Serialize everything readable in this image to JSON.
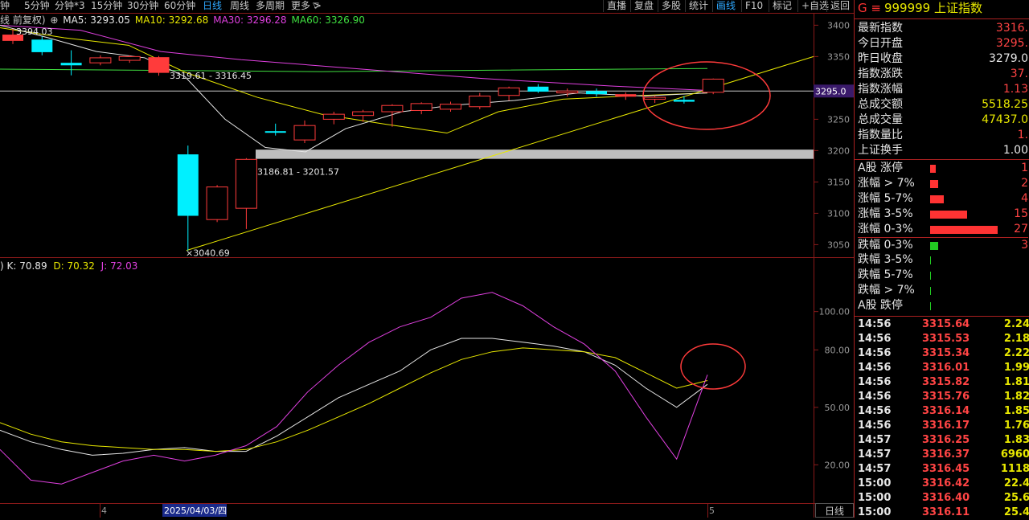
{
  "toolbar": {
    "left_items": [
      "钟",
      "5分钟",
      "分钟*3",
      "15分钟",
      "30分钟",
      "60分钟",
      "日线",
      "周线",
      "多周期",
      "更多 >"
    ],
    "selected": "日线",
    "right_items": [
      "直播",
      "复盘",
      "多股",
      "统计",
      "画线",
      "F10",
      "标记",
      "+自选",
      "返回"
    ],
    "right_selected": "画线"
  },
  "ma_legend": {
    "prefix": "线 前复权)",
    "items": [
      {
        "label": "MA5: 3293.05",
        "color": "#e6e6e6"
      },
      {
        "label": "MA10: 3292.68",
        "color": "#e8e800"
      },
      {
        "label": "MA30: 3296.28",
        "color": "#e040e0"
      },
      {
        "label": "MA60: 3326.90",
        "color": "#40e040"
      }
    ]
  },
  "kdj_legend": {
    "prefix": ") K: 70.89",
    "items": [
      {
        "label": "D: 70.32",
        "color": "#e8e800"
      },
      {
        "label": "J: 72.03",
        "color": "#e040e0"
      }
    ]
  },
  "chart_data": [
    {
      "type": "candlestick",
      "y_ticks": [
        "3400",
        "3350",
        "3300",
        "3250",
        "3200",
        "3150",
        "3100",
        "3050"
      ],
      "ylim": [
        3030,
        3412
      ],
      "candles": [
        {
          "o": 3385,
          "h": 3394.03,
          "l": 3370,
          "c": 3375,
          "up": false
        },
        {
          "o": 3377,
          "h": 3382,
          "l": 3352,
          "c": 3357,
          "up": false
        },
        {
          "o": 3340,
          "h": 3360,
          "l": 3320,
          "c": 3336,
          "up": false
        },
        {
          "o": 3340,
          "h": 3352,
          "l": 3336,
          "c": 3348,
          "up": true
        },
        {
          "o": 3344,
          "h": 3352,
          "l": 3340,
          "c": 3350,
          "up": true
        },
        {
          "o": 3349,
          "h": 3351,
          "l": 3319.61,
          "c": 3324,
          "up": false
        },
        {
          "o": 3194,
          "h": 3208,
          "l": 3040.69,
          "c": 3096,
          "up": false
        },
        {
          "o": 3090,
          "h": 3145,
          "l": 3086,
          "c": 3142,
          "up": true
        },
        {
          "o": 3108,
          "h": 3188,
          "l": 3075,
          "c": 3186,
          "up": true
        },
        {
          "o": 3231,
          "h": 3243,
          "l": 3224,
          "c": 3231,
          "up": false
        },
        {
          "o": 3217,
          "h": 3248,
          "l": 3212,
          "c": 3240,
          "up": true
        },
        {
          "o": 3250,
          "h": 3262,
          "l": 3242,
          "c": 3258,
          "up": true
        },
        {
          "o": 3256,
          "h": 3265,
          "l": 3246,
          "c": 3262,
          "up": true
        },
        {
          "o": 3262,
          "h": 3274,
          "l": 3238,
          "c": 3272,
          "up": true
        },
        {
          "o": 3264,
          "h": 3277,
          "l": 3258,
          "c": 3275,
          "up": true
        },
        {
          "o": 3266,
          "h": 3278,
          "l": 3262,
          "c": 3274,
          "up": true
        },
        {
          "o": 3270,
          "h": 3292,
          "l": 3266,
          "c": 3287,
          "up": true
        },
        {
          "o": 3288,
          "h": 3302,
          "l": 3280,
          "c": 3300,
          "up": true
        },
        {
          "o": 3302,
          "h": 3306,
          "l": 3292,
          "c": 3294,
          "up": false
        },
        {
          "o": 3292,
          "h": 3299,
          "l": 3286,
          "c": 3295,
          "up": true
        },
        {
          "o": 3295,
          "h": 3299,
          "l": 3286,
          "c": 3290,
          "up": false
        },
        {
          "o": 3290,
          "h": 3293,
          "l": 3281,
          "c": 3286,
          "up": false
        },
        {
          "o": 3282,
          "h": 3288,
          "l": 3276,
          "c": 3285,
          "up": true
        },
        {
          "o": 3281,
          "h": 3287,
          "l": 3275,
          "c": 3278,
          "up": false
        },
        {
          "o": 3293,
          "h": 3315,
          "l": 3290,
          "c": 3314,
          "up": true
        }
      ],
      "annotations": [
        {
          "text": "3394.03"
        },
        {
          "text": "3319.61 - 3316.45"
        },
        {
          "text": "3186.81 - 3201.57"
        },
        {
          "text": "3040.69"
        }
      ],
      "current_price_tag": "3295.0"
    },
    {
      "type": "line",
      "y_ticks": [
        "100.00",
        "80.00",
        "50.00",
        "20.00"
      ],
      "ylim": [
        0,
        120
      ],
      "series": [
        {
          "name": "K",
          "color": "#e6e6e6",
          "values": [
            38,
            32,
            28,
            25,
            26,
            28,
            29,
            27,
            27,
            35,
            45,
            55,
            62,
            69,
            80,
            86,
            86,
            84,
            82,
            79,
            72,
            60,
            50,
            62
          ]
        },
        {
          "name": "D",
          "color": "#e8e800",
          "values": [
            42,
            36,
            32,
            30,
            29,
            28,
            28,
            27,
            28,
            32,
            38,
            45,
            52,
            60,
            68,
            75,
            79,
            81,
            80,
            79,
            76,
            68,
            60,
            64
          ]
        },
        {
          "name": "J",
          "color": "#e040e0",
          "values": [
            28,
            12,
            10,
            16,
            22,
            25,
            22,
            25,
            30,
            40,
            58,
            72,
            84,
            92,
            97,
            107,
            110,
            103,
            92,
            83,
            69,
            45,
            23,
            67
          ]
        }
      ],
      "x_labels": [
        "4",
        "2025/04/03/四",
        "5"
      ]
    }
  ],
  "quote_panel": {
    "code": "999999",
    "name": "上证指数",
    "marker": "G ≡",
    "rows": [
      {
        "label": "最新指数",
        "value": "3316.",
        "color": "#ff4444"
      },
      {
        "label": "今日开盘",
        "value": "3295.",
        "color": "#ff4444"
      },
      {
        "label": "昨日收盘",
        "value": "3279.0",
        "color": "#e6e6e6"
      },
      {
        "label": "指数涨跌",
        "value": "37.",
        "color": "#ff4444"
      },
      {
        "label": "指数涨幅",
        "value": "1.13",
        "color": "#ff4444"
      },
      {
        "label": "总成交额",
        "value": "5518.25",
        "color": "#e8e800"
      },
      {
        "label": "总成交量",
        "value": "47437.0",
        "color": "#e8e800"
      },
      {
        "label": "指数量比",
        "value": "1.",
        "color": "#ff4444"
      },
      {
        "label": "上证换手",
        "value": "1.00",
        "color": "#e6e6e6"
      }
    ],
    "dist_rows": [
      {
        "label": "A股 涨停",
        "value": "1",
        "bar": 0.03,
        "color": "#ff3333"
      },
      {
        "label": "涨幅 > 7%",
        "value": "2",
        "bar": 0.04,
        "color": "#ff3333"
      },
      {
        "label": "涨幅 5-7%",
        "value": "4",
        "bar": 0.07,
        "color": "#ff3333"
      },
      {
        "label": "涨幅 3-5%",
        "value": "15",
        "bar": 0.19,
        "color": "#ff3333"
      },
      {
        "label": "涨幅 0-3%",
        "value": "27",
        "bar": 0.35,
        "color": "#ff3333"
      },
      {
        "label": "跌幅 0-3%",
        "value": "3",
        "bar": 0.04,
        "color": "#22cc22"
      },
      {
        "label": "跌幅 3-5%",
        "value": "",
        "bar": 0.005,
        "color": "#22cc22"
      },
      {
        "label": "跌幅 5-7%",
        "value": "",
        "bar": 0.005,
        "color": "#22cc22"
      },
      {
        "label": "跌幅 > 7%",
        "value": "",
        "bar": 0.005,
        "color": "#22cc22"
      },
      {
        "label": "A股 跌停",
        "value": "",
        "bar": 0.005,
        "color": "#22cc22"
      }
    ],
    "ticks": [
      {
        "time": "14:56",
        "price": "3315.64",
        "vol": "2.24"
      },
      {
        "time": "14:56",
        "price": "3315.53",
        "vol": "2.18"
      },
      {
        "time": "14:56",
        "price": "3315.34",
        "vol": "2.22"
      },
      {
        "time": "14:56",
        "price": "3316.01",
        "vol": "1.99"
      },
      {
        "time": "14:56",
        "price": "3315.82",
        "vol": "1.81"
      },
      {
        "time": "14:56",
        "price": "3315.76",
        "vol": "1.82"
      },
      {
        "time": "14:56",
        "price": "3316.14",
        "vol": "1.85"
      },
      {
        "time": "14:56",
        "price": "3316.17",
        "vol": "1.76"
      },
      {
        "time": "14:57",
        "price": "3316.25",
        "vol": "1.83"
      },
      {
        "time": "14:57",
        "price": "3316.37",
        "vol": "6960"
      },
      {
        "time": "14:57",
        "price": "3316.45",
        "vol": "1118"
      },
      {
        "time": "15:00",
        "price": "3316.42",
        "vol": "22.4"
      },
      {
        "time": "15:00",
        "price": "3316.40",
        "vol": "25.6"
      },
      {
        "time": "15:00",
        "price": "3316.11",
        "vol": "25.4"
      }
    ]
  },
  "bottom_button": "日线"
}
